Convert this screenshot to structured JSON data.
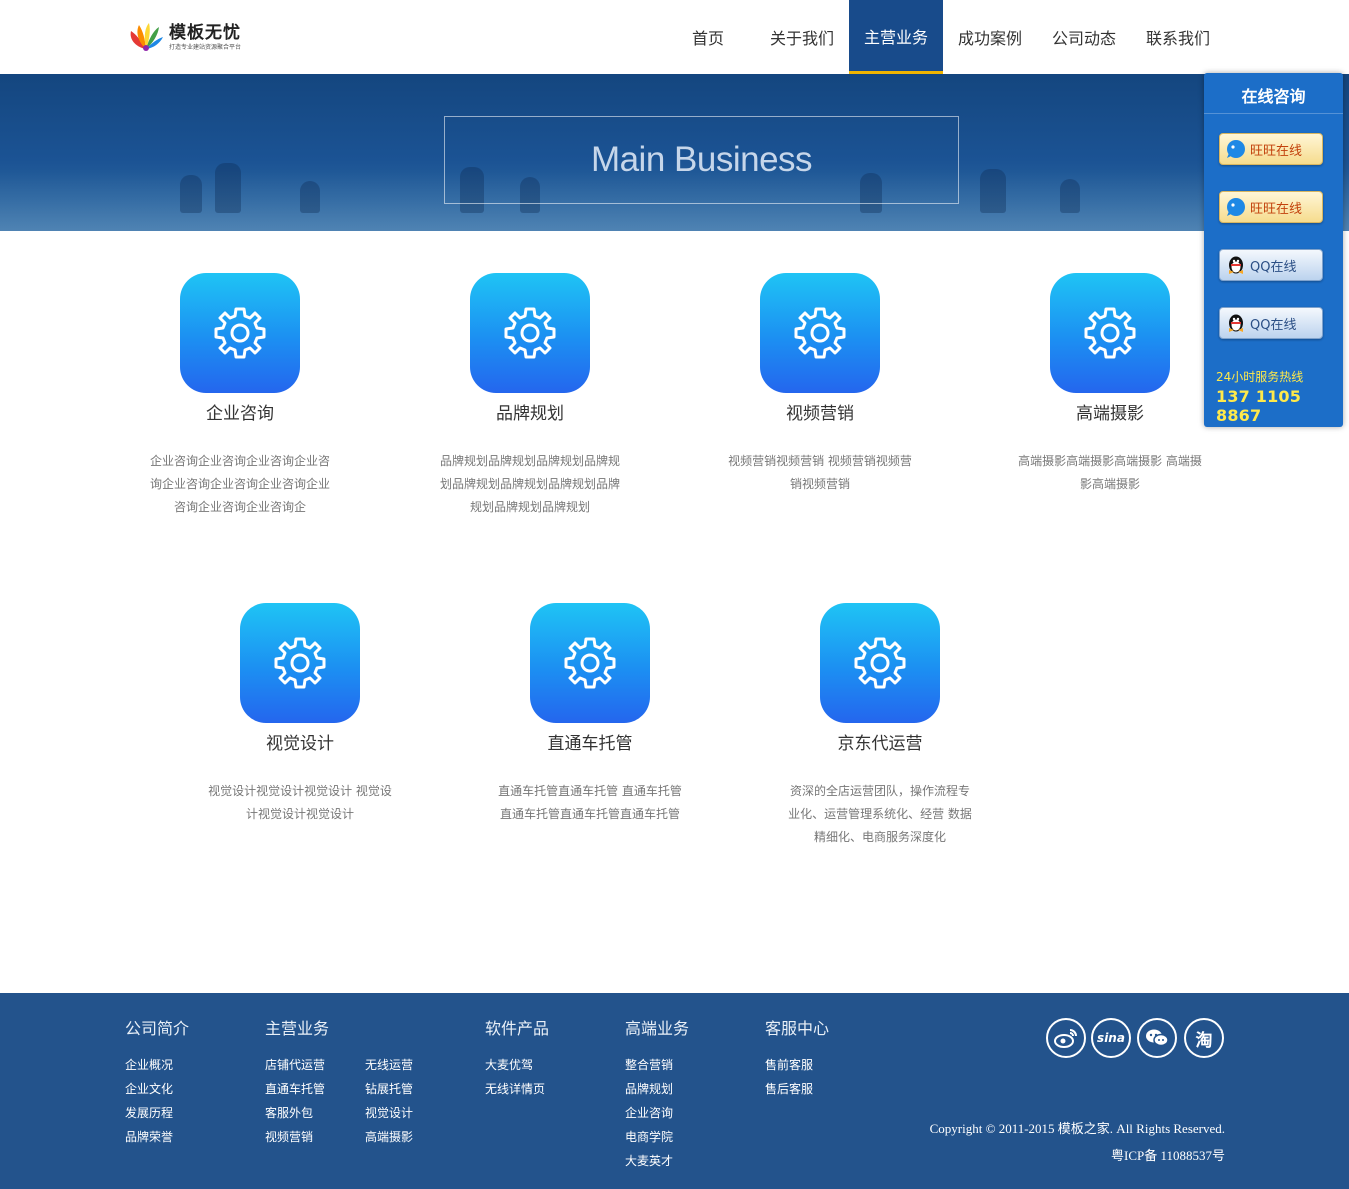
{
  "header": {
    "logo_title": "模板无忧",
    "logo_subtitle": "打造专业建站资源聚合平台",
    "nav": [
      {
        "label": "首页",
        "active": false
      },
      {
        "label": "关于我们",
        "active": false
      },
      {
        "label": "主营业务",
        "active": true
      },
      {
        "label": "成功案例",
        "active": false
      },
      {
        "label": "公司动态",
        "active": false
      },
      {
        "label": "联系我们",
        "active": false
      }
    ]
  },
  "banner": {
    "title": "Main Business"
  },
  "services": [
    {
      "name": "企业咨询",
      "desc": "企业咨询企业咨询企业咨询企业咨询企业咨询企业咨询企业咨询企业咨询企业咨询企业咨询企",
      "icon": "gear-icon"
    },
    {
      "name": "品牌规划",
      "desc": "品牌规划品牌规划品牌规划品牌规划品牌规划品牌规划品牌规划品牌规划品牌规划品牌规划",
      "icon": "gear-icon"
    },
    {
      "name": "视频营销",
      "desc": "视频营销视频营销 视频营销视频营销视频营销",
      "icon": "gear-icon"
    },
    {
      "name": "高端摄影",
      "desc": "高端摄影高端摄影高端摄影 高端摄影高端摄影",
      "icon": "gear-icon"
    },
    {
      "name": "视觉设计",
      "desc": "视觉设计视觉设计视觉设计 视觉设计视觉设计视觉设计",
      "icon": "gear-icon"
    },
    {
      "name": "直通车托管",
      "desc": "直通车托管直通车托管 直通车托管直通车托管直通车托管直通车托管",
      "icon": "gear-icon"
    },
    {
      "name": "京东代运营",
      "desc": "资深的全店运营团队，操作流程专业化、运营管理系统化、经营 数据精细化、电商服务深度化",
      "icon": "gear-icon"
    }
  ],
  "float_panel": {
    "title": "在线咨询",
    "buttons": [
      {
        "label": "旺旺在线",
        "type": "wangwang",
        "icon": "wangwang-icon"
      },
      {
        "label": "旺旺在线",
        "type": "wangwang",
        "icon": "wangwang-icon"
      },
      {
        "label": "QQ在线",
        "type": "qq",
        "icon": "qq-penguin-icon"
      },
      {
        "label": "QQ在线",
        "type": "qq",
        "icon": "qq-penguin-icon"
      }
    ],
    "hotline_label": "24小时服务热线",
    "hotline": "137 1105 8867"
  },
  "footer": {
    "columns": [
      {
        "title": "公司简介",
        "links": [
          "企业概况",
          "企业文化",
          "发展历程",
          "品牌荣誉"
        ]
      },
      {
        "title": "主营业务",
        "links": [
          "店铺代运营",
          "直通车托管",
          "客服外包",
          "视频营销"
        ],
        "links2": [
          "无线运营",
          "钻展托管",
          "视觉设计",
          "高端摄影"
        ]
      },
      {
        "title": "软件产品",
        "links": [
          "大麦优驾",
          "无线详情页"
        ]
      },
      {
        "title": "高端业务",
        "links": [
          "整合营销",
          "品牌规划",
          "企业咨询",
          "电商学院",
          "大麦英才"
        ]
      },
      {
        "title": "客服中心",
        "links": [
          "售前客服",
          "售后客服"
        ]
      }
    ],
    "social": [
      {
        "name": "weibo",
        "icon": "weibo-icon"
      },
      {
        "name": "sina",
        "icon": "sina-icon",
        "text": "sina"
      },
      {
        "name": "wechat",
        "icon": "wechat-icon"
      },
      {
        "name": "taobao",
        "icon": "taobao-icon",
        "text": "淘"
      }
    ],
    "copyright": "Copyright © 2011-2015 模板之家. All Rights Reserved.",
    "icp": "粤ICP备 11088537号"
  },
  "colors": {
    "nav_active": "#184b8b",
    "nav_active_underline": "#f0b400",
    "banner": "#1b5394",
    "footer": "#23538c",
    "float_panel": "#1c6ec8",
    "hotline": "#ffe94a",
    "icon_gradient_top": "#1fc4f5",
    "icon_gradient_bottom": "#2466ee"
  }
}
